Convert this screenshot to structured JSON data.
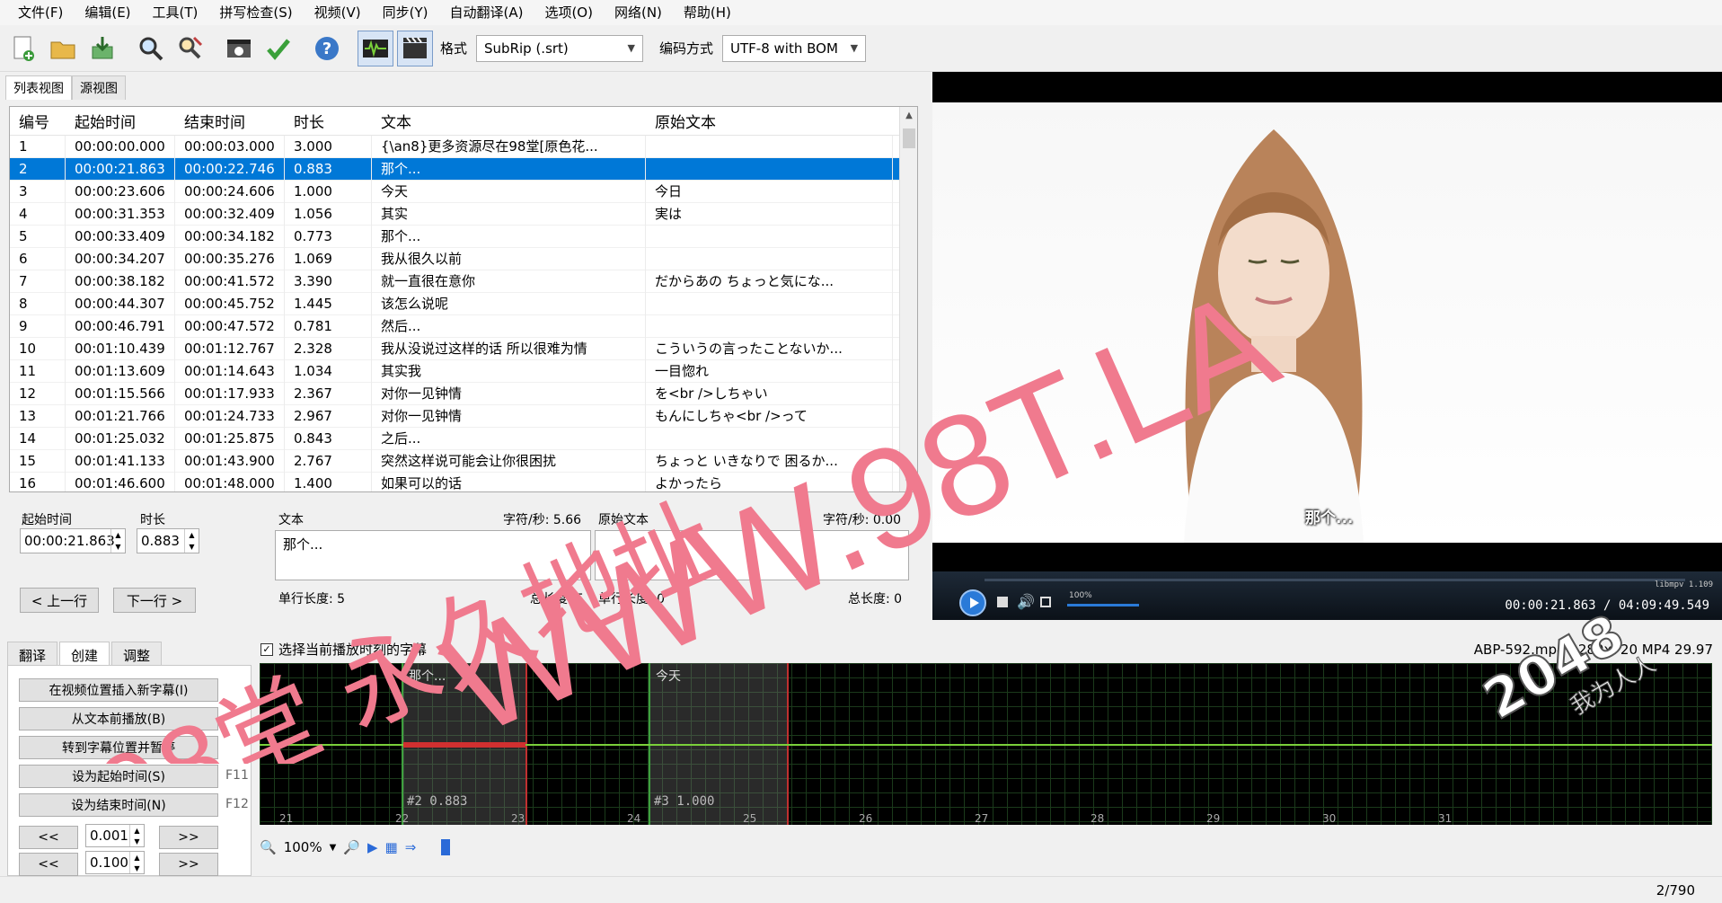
{
  "menu": [
    "文件(F)",
    "编辑(E)",
    "工具(T)",
    "拼写检查(S)",
    "视频(V)",
    "同步(Y)",
    "自动翻译(A)",
    "选项(O)",
    "网络(N)",
    "帮助(H)"
  ],
  "toolbar": {
    "format_label": "格式",
    "format_value": "SubRip (.srt)",
    "encoding_label": "编码方式",
    "encoding_value": "UTF-8 with BOM"
  },
  "view_tabs": [
    "列表视图",
    "源视图"
  ],
  "list": {
    "headers": [
      "编号",
      "起始时间",
      "结束时间",
      "时长",
      "文本",
      "原始文本"
    ],
    "rows": [
      [
        "1",
        "00:00:00.000",
        "00:00:03.000",
        "3.000",
        "{\\an8}更多资源尽在98堂[原色花...",
        ""
      ],
      [
        "2",
        "00:00:21.863",
        "00:00:22.746",
        "0.883",
        "那个...",
        ""
      ],
      [
        "3",
        "00:00:23.606",
        "00:00:24.606",
        "1.000",
        "今天",
        "今日"
      ],
      [
        "4",
        "00:00:31.353",
        "00:00:32.409",
        "1.056",
        "其实",
        "実は"
      ],
      [
        "5",
        "00:00:33.409",
        "00:00:34.182",
        "0.773",
        "那个...",
        ""
      ],
      [
        "6",
        "00:00:34.207",
        "00:00:35.276",
        "1.069",
        "我从很久以前",
        ""
      ],
      [
        "7",
        "00:00:38.182",
        "00:00:41.572",
        "3.390",
        "就一直很在意你",
        "だからあの ちょっと気にな..."
      ],
      [
        "8",
        "00:00:44.307",
        "00:00:45.752",
        "1.445",
        "该怎么说呢",
        ""
      ],
      [
        "9",
        "00:00:46.791",
        "00:00:47.572",
        "0.781",
        "然后...",
        ""
      ],
      [
        "10",
        "00:01:10.439",
        "00:01:12.767",
        "2.328",
        "我从没说过这样的话 所以很难为情",
        "こういうの言ったことないか..."
      ],
      [
        "11",
        "00:01:13.609",
        "00:01:14.643",
        "1.034",
        "其实我",
        "一目惚れ"
      ],
      [
        "12",
        "00:01:15.566",
        "00:01:17.933",
        "2.367",
        "对你一见钟情",
        "を<br />しちゃい"
      ],
      [
        "13",
        "00:01:21.766",
        "00:01:24.733",
        "2.967",
        "对你一见钟情",
        "もんにしちゃ<br />って"
      ],
      [
        "14",
        "00:01:25.032",
        "00:01:25.875",
        "0.843",
        "之后...",
        ""
      ],
      [
        "15",
        "00:01:41.133",
        "00:01:43.900",
        "2.767",
        "突然这样说可能会让你很困扰",
        "ちょっと いきなりで 困るか..."
      ],
      [
        "16",
        "00:01:46.600",
        "00:01:48.000",
        "1.400",
        "如果可以的话",
        "よかったら"
      ]
    ],
    "selected_index": 1
  },
  "edit": {
    "start_label": "起始时间",
    "start_value": "00:00:21.863",
    "duration_label": "时长",
    "duration_value": "0.883",
    "text_label": "文本",
    "cps_label": "字符/秒: 5.66",
    "orig_label": "原始文本",
    "orig_cps_label": "字符/秒: 0.00",
    "text_value": "那个...",
    "single_len": "单行长度: 5",
    "total_len": "总长度: 5",
    "orig_single_len": "单行长度: 0",
    "orig_total_len": "总长度: 0",
    "prev_button": "< 上一行",
    "next_button": "下一行 >"
  },
  "video": {
    "subtitle": "那个...",
    "volume": "100%",
    "decoder": "libmpv 1.109",
    "timecode": "00:00:21.863 / 04:09:49.549"
  },
  "bottom_tabs": [
    "翻译",
    "创建",
    "调整"
  ],
  "create": {
    "btn1": "在视频位置插入新字幕(I)",
    "btn2": "从文本前播放(B)",
    "btn3": "转到字幕位置并暂停",
    "btn4": "设为起始时间(S)",
    "btn5": "设为结束时间(N)",
    "f11": "F11",
    "f12": "F12",
    "rewind": "<<",
    "forward": ">>",
    "step1": "0.001",
    "step2": "0.100"
  },
  "checkbox_label": "选择当前播放时刻的字幕",
  "fileinfo": "ABP-592.mp4 1280x720 MP4 29.97",
  "waveform": {
    "label_a": "那个...",
    "label_b": "今天",
    "mark_a": "#2  0.883",
    "mark_b": "#3  1.000",
    "ticks": [
      "21",
      "22",
      "23",
      "24",
      "25",
      "26",
      "27",
      "28",
      "29",
      "30",
      "31"
    ],
    "zoom": "100%"
  },
  "status": {
    "position": "2/790"
  },
  "watermark": {
    "url": "WWW.98T.LA",
    "chinese": "98堂 永久地址",
    "corner": "2048",
    "corner_sub": "我为人人"
  },
  "colors": {
    "selection": "#0078d7",
    "waveform_line": "#7ad03a",
    "watermark": "#f07a8e"
  }
}
